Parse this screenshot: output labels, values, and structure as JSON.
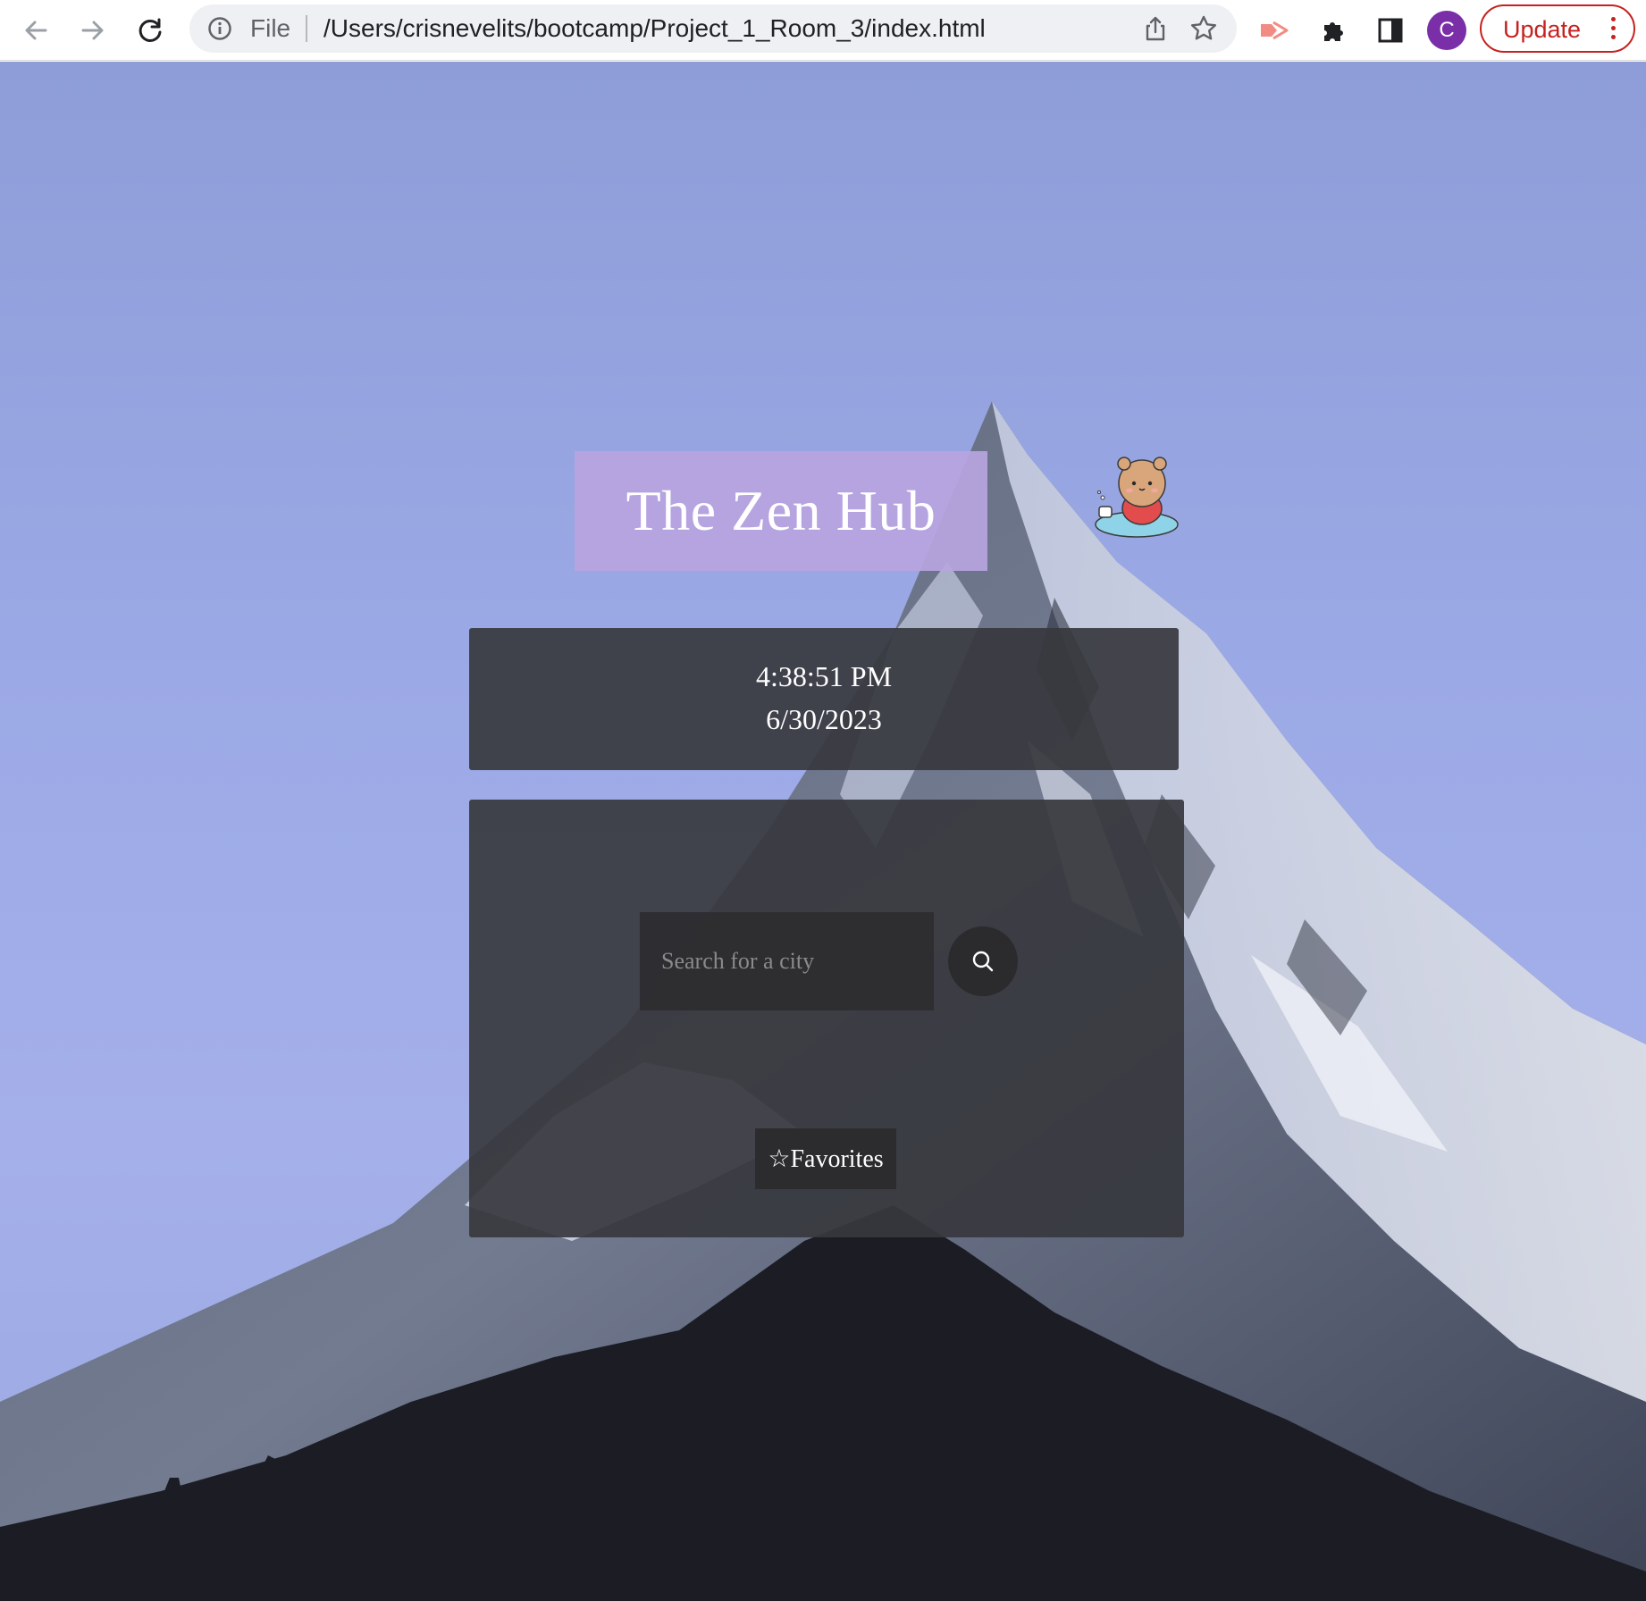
{
  "browser": {
    "url_scheme": "File",
    "url_path": "/Users/crisnevelits/bootcamp/Project_1_Room_3/index.html",
    "profile_initial": "C",
    "update_label": "Update",
    "accent_color": "#c5221f",
    "icons": [
      "back-arrow-icon",
      "forward-arrow-icon",
      "reload-icon",
      "info-icon",
      "share-icon",
      "bookmark-star-icon",
      "extension-arrow-icon",
      "puzzle-icon",
      "side-panel-icon",
      "kebab-menu-icon"
    ]
  },
  "page": {
    "title": "The Zen Hub",
    "clock": {
      "time": "4:38:51 PM",
      "date": "6/30/2023"
    },
    "search": {
      "placeholder": "Search for a city",
      "value": ""
    },
    "favorites_label": "☆Favorites",
    "colors": {
      "title_bg": "#b8a4e0",
      "panel_bg": "#37383e",
      "sky": "#9ba9e6"
    }
  }
}
